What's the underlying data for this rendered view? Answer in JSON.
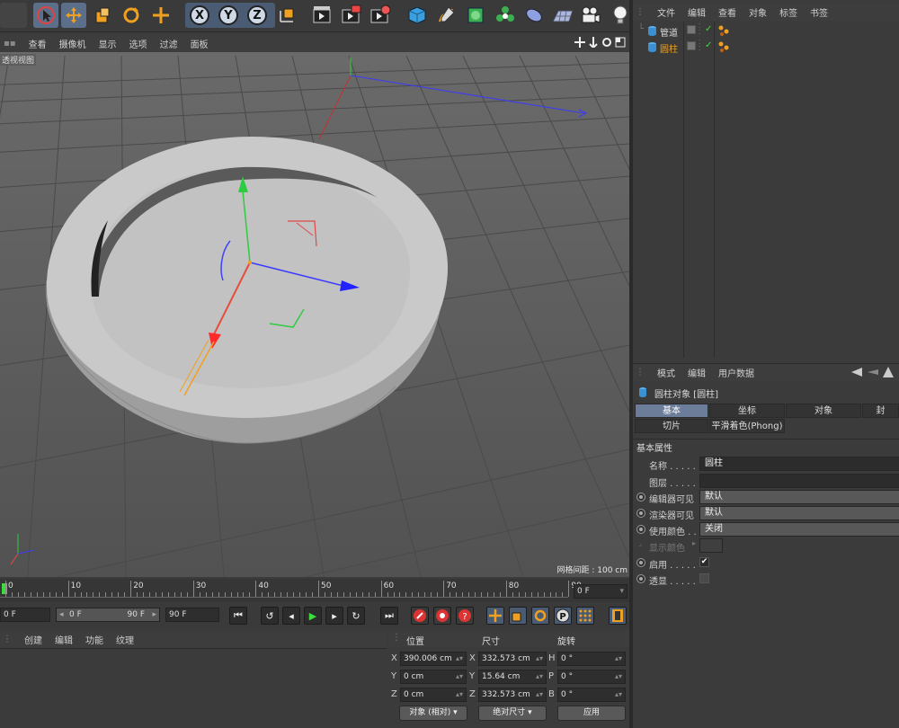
{
  "toolbar": {
    "axis_x": "X",
    "axis_y": "Y",
    "axis_z": "Z"
  },
  "viewport_menu": [
    "查看",
    "摄像机",
    "显示",
    "选项",
    "过滤",
    "面板"
  ],
  "viewport": {
    "label": "透视视图",
    "grid_spacing": "网格间距 : 100 cm"
  },
  "timeline": {
    "ticks": [
      "0",
      "10",
      "20",
      "30",
      "40",
      "50",
      "60",
      "70",
      "80",
      "90"
    ],
    "current_frame": "0 F"
  },
  "frames": {
    "start": "0 F",
    "range_start": "0 F",
    "range_end": "90 F",
    "end": "90 F"
  },
  "material_menu": [
    "创建",
    "编辑",
    "功能",
    "纹理"
  ],
  "coordinates": {
    "header_position": "位置",
    "header_size": "尺寸",
    "header_rotation": "旋转",
    "rows": [
      {
        "axis": "X",
        "pos": "390.006 cm",
        "size_axis": "X",
        "size": "332.573 cm",
        "rot_axis": "H",
        "rot": "0 °"
      },
      {
        "axis": "Y",
        "pos": "0 cm",
        "size_axis": "Y",
        "size": "15.64 cm",
        "rot_axis": "P",
        "rot": "0 °"
      },
      {
        "axis": "Z",
        "pos": "0 cm",
        "size_axis": "Z",
        "size": "332.573 cm",
        "rot_axis": "B",
        "rot": "0 °"
      }
    ],
    "mode_object": "对象 (相对)",
    "mode_size": "绝对尺寸",
    "apply": "应用"
  },
  "object_manager": {
    "menu": [
      "文件",
      "编辑",
      "查看",
      "对象",
      "标签",
      "书签"
    ],
    "objects": [
      {
        "name": "管道"
      },
      {
        "name": "圆柱"
      }
    ]
  },
  "attribute_manager": {
    "menu": [
      "模式",
      "编辑",
      "用户数据"
    ],
    "object_title": "圆柱对象 [圆柱]",
    "tabs_row1": [
      "基本",
      "坐标",
      "对象",
      "封"
    ],
    "tabs_row2": [
      "切片",
      "平滑着色(Phong)"
    ],
    "section": "基本属性",
    "props": [
      {
        "label": "名称 . . . . .",
        "value": "圆柱"
      },
      {
        "label": "图层 . . . . .",
        "value": ""
      },
      {
        "label": "编辑器可见",
        "value": "默认"
      },
      {
        "label": "渲染器可见",
        "value": "默认"
      },
      {
        "label": "使用颜色 . .",
        "value": "关闭"
      },
      {
        "label": "显示颜色",
        "value": ""
      },
      {
        "label": "启用 . . . . .",
        "value": "✔"
      },
      {
        "label": "透显 . . . . .",
        "value": ""
      }
    ]
  }
}
